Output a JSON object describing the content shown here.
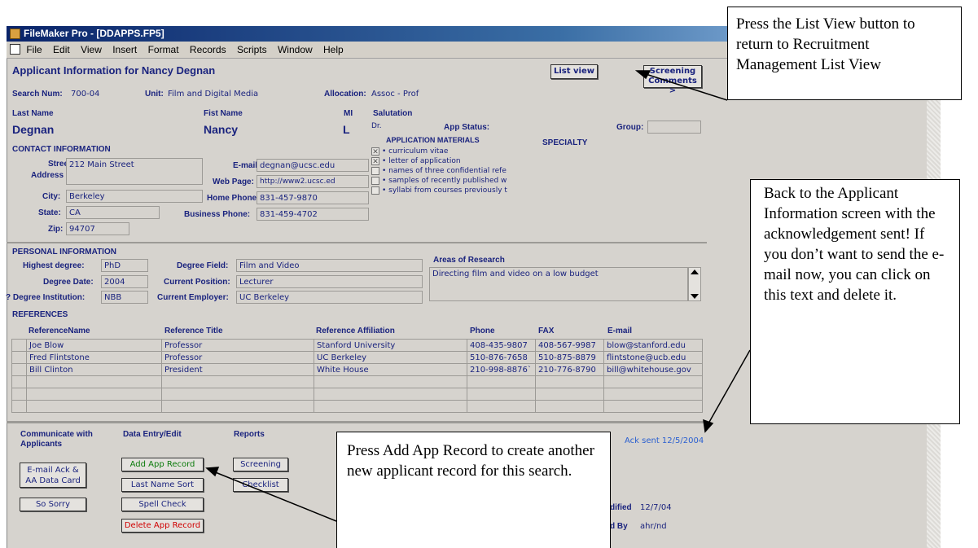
{
  "window": {
    "title": "FileMaker Pro - [DDAPPS.FP5]"
  },
  "menu": [
    "File",
    "Edit",
    "View",
    "Insert",
    "Format",
    "Records",
    "Scripts",
    "Window",
    "Help"
  ],
  "header": {
    "title": "Applicant Information for Nancy Degnan",
    "list_view_label": "List view",
    "screening_comments_label": "Screening Comments >"
  },
  "search": {
    "num_label": "Search Num:",
    "num": "700-04",
    "unit_label": "Unit:",
    "unit": "Film and Digital Media",
    "allocation_label": "Allocation:",
    "allocation": "Assoc - Prof"
  },
  "name": {
    "last_label": "Last Name",
    "first_label": "Fist Name",
    "mi_label": "MI",
    "salutation_label": "Salutation",
    "last": "Degnan",
    "first": "Nancy",
    "mi": "L",
    "salutation": "Dr.",
    "app_status_label": "App Status:",
    "group_label": "Group:"
  },
  "contact": {
    "section": "CONTACT INFORMATION",
    "street_label": "Street",
    "address_label": "Address",
    "street": "212 Main Street",
    "city_label": "City:",
    "city": "Berkeley",
    "state_label": "State:",
    "state": "CA",
    "zip_label": "Zip:",
    "zip": "94707",
    "email_label": "E-mail:",
    "email": "degnan@ucsc.edu",
    "web_label": "Web Page:",
    "web": "http://www2.ucsc.ed",
    "home_phone_label": "Home Phone:",
    "home_phone": "831-457-9870",
    "business_phone_label": "Business Phone:",
    "business_phone": "831-459-4702"
  },
  "materials": {
    "title": "APPLICATION MATERIALS",
    "specialty_label": "SPECIALTY",
    "items": [
      {
        "label": "• curriculum vitae",
        "checked": true
      },
      {
        "label": "• letter of application",
        "checked": true
      },
      {
        "label": "• names of three confidential refe",
        "checked": false
      },
      {
        "label": "• samples of recently published w",
        "checked": false
      },
      {
        "label": "• syllabi from courses previously t",
        "checked": false
      }
    ]
  },
  "personal": {
    "section": "PERSONAL INFORMATION",
    "highest_degree_label": "Highest degree:",
    "highest_degree": "PhD",
    "degree_date_label": "Degree Date:",
    "degree_date": "2004",
    "degree_inst_label": "? Degree Institution:",
    "degree_inst": "NBB",
    "degree_field_label": "Degree Field:",
    "degree_field": "Film and Video",
    "current_position_label": "Current Position:",
    "current_position": "Lecturer",
    "current_employer_label": "Current Employer:",
    "current_employer": "UC Berkeley",
    "areas_label": "Areas of Research",
    "areas": "Directing film and video on a low budget"
  },
  "references": {
    "section": "REFERENCES",
    "columns": [
      "ReferenceName",
      "Reference Title",
      "Reference Affiliation",
      "Phone",
      "FAX",
      "E-mail"
    ],
    "rows": [
      [
        "Joe Blow",
        "Professor",
        "Stanford University",
        "408-435-9807",
        "408-567-9987",
        "blow@stanford.edu"
      ],
      [
        "Fred Flintstone",
        "Professor",
        "UC Berkeley",
        "510-876-7658",
        "510-875-8879",
        "flintstone@ucb.edu"
      ],
      [
        "Bill Clinton",
        "President",
        "White House",
        "210-998-8876`",
        "210-776-8790",
        "bill@whitehouse.gov"
      ],
      [
        "",
        "",
        "",
        "",
        "",
        ""
      ],
      [
        "",
        "",
        "",
        "",
        "",
        ""
      ],
      [
        "",
        "",
        "",
        "",
        "",
        ""
      ]
    ]
  },
  "footer": {
    "communicate_label": "Communicate with Applicants",
    "data_entry_label": "Data Entry/Edit",
    "reports_label": "Reports",
    "ack_sent": "Ack sent 12/5/2004",
    "email_ack_label": "E-mail Ack & AA Data Card",
    "so_sorry_label": "So Sorry",
    "add_app_label": "Add App Record",
    "last_name_sort_label": "Last Name Sort",
    "spell_check_label": "Spell Check",
    "delete_app_label": "Delete App Record",
    "screening_label": "Screening",
    "checklist_label": "Checklist",
    "modified_label": "dified",
    "modified": "12/7/04",
    "modified_by_label": "d By",
    "modified_by": "ahr/nd"
  },
  "callouts": {
    "list_view": "Press the List View button to return to Recruitment Management List View",
    "ack": "Back to the Applicant Information screen with the acknowledgement sent!  If you don’t want to send the e-mail now, you can click on this text and delete it.",
    "add_app": "Press Add App Record to create another new applicant record for this search."
  }
}
